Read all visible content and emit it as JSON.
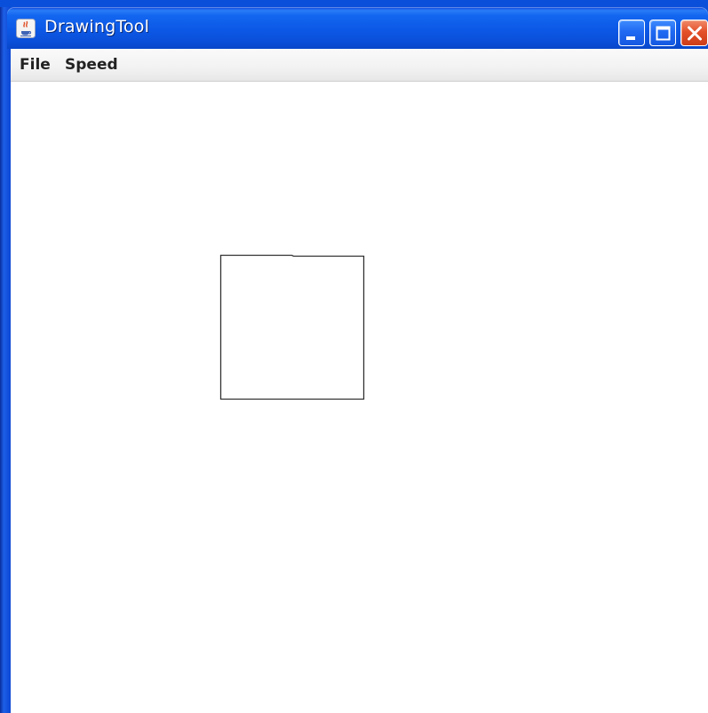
{
  "window": {
    "title": "DrawingTool",
    "app_icon": "java-cup-icon",
    "title_color": "#0a4fd9"
  },
  "titlebar_buttons": {
    "minimize": "minimize-icon",
    "maximize": "maximize-icon",
    "close": "close-icon",
    "close_color": "#e4512b"
  },
  "menubar": {
    "items": [
      {
        "label": "File"
      },
      {
        "label": "Speed"
      }
    ]
  },
  "canvas": {
    "background": "#ffffff",
    "stroke_color": "#333333",
    "shapes": [
      {
        "type": "square-outline"
      }
    ]
  }
}
